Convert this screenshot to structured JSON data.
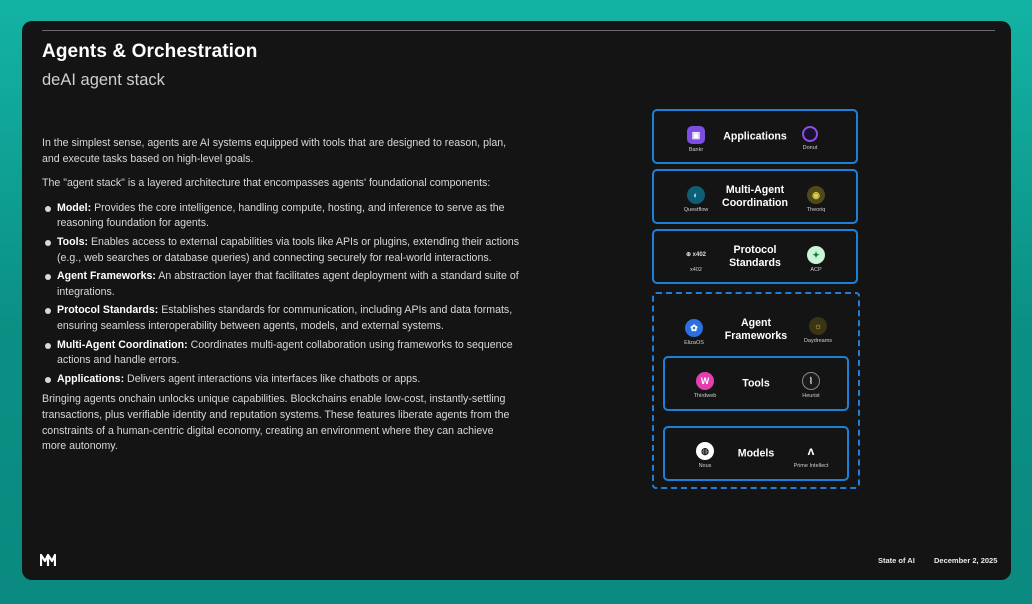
{
  "slide": {
    "title": "Agents & Orchestration",
    "subtitle": "deAI agent stack"
  },
  "body": {
    "intro": "In the simplest sense, agents are AI systems equipped with tools that are designed to reason, plan, and execute tasks based on high-level goals.",
    "stack_intro": "The \"agent stack\" is a layered architecture that encompasses agents' foundational components:",
    "bullets": [
      {
        "term": "Model:",
        "text": " Provides the core intelligence, handling compute, hosting, and inference to serve as the reasoning foundation for agents."
      },
      {
        "term": "Tools:",
        "text": " Enables access to external capabilities via tools like APIs or plugins, extending their actions (e.g., web searches or database queries) and connecting securely for real-world interactions."
      },
      {
        "term": "Agent Frameworks:",
        "text": " An abstraction layer that facilitates agent deployment with a standard suite of integrations."
      },
      {
        "term": "Protocol Standards:",
        "text": " Establishes standards for communication, including APIs and data formats, ensuring seamless interoperability between agents, models, and external systems."
      },
      {
        "term": "Multi-Agent Coordination:",
        "text": " Coordinates multi-agent collaboration using frameworks to sequence actions and handle errors."
      },
      {
        "term": "Applications:",
        "text": " Delivers agent interactions via interfaces like chatbots or apps."
      }
    ],
    "closing": "Bringing agents onchain unlocks unique capabilities. Blockchains enable low-cost, instantly-settling transactions, plus verifiable identity and reputation systems. These features liberate agents from the constraints of a human-centric digital economy, creating an environment where they can achieve more autonomy."
  },
  "stack": {
    "layers": [
      {
        "label": "Applications",
        "left_logo": {
          "name": "Bankr",
          "icon": "bankr-logo-icon",
          "color": "#7b4de0"
        },
        "right_logo": {
          "name": "Donut",
          "icon": "donut-logo-icon",
          "color": "#8a4fe8"
        }
      },
      {
        "label": "Multi-Agent\nCoordination",
        "left_logo": {
          "name": "Questflow",
          "icon": "questflow-logo-icon",
          "color": "#1aa6c9"
        },
        "right_logo": {
          "name": "Theoriq",
          "icon": "theoriq-logo-icon",
          "color": "#c8b43a"
        }
      },
      {
        "label": "Protocol\nStandards",
        "left_logo": {
          "name": "x402",
          "mark": "⊕ x402",
          "icon": "x402-logo-icon",
          "color": "#cccccc"
        },
        "right_logo": {
          "name": "ACP",
          "icon": "acp-logo-icon",
          "color": "#9be8b5"
        }
      },
      {
        "label": "Agent\nFrameworks",
        "left_logo": {
          "name": "ElizaOS",
          "icon": "elizaos-logo-icon",
          "color": "#2b6fe0"
        },
        "right_logo": {
          "name": "Daydreams",
          "icon": "daydreams-logo-icon",
          "color": "#c8a63a"
        }
      },
      {
        "label": "Tools",
        "left_logo": {
          "name": "Thirdweb",
          "icon": "thirdweb-logo-icon",
          "color": "#e23fb0"
        },
        "right_logo": {
          "name": "Heurist",
          "icon": "heurist-logo-icon",
          "color": "#ffffff"
        }
      },
      {
        "label": "Models",
        "left_logo": {
          "name": "Nous",
          "icon": "nous-logo-icon",
          "color": "#ffffff"
        },
        "right_logo": {
          "name": "Prime Intellect",
          "icon": "prime-intellect-logo-icon",
          "color": "#ffffff"
        }
      }
    ],
    "accent_color": "#1f7fd8"
  },
  "footer": {
    "report": "State of AI",
    "date": "December 2, 2025"
  }
}
